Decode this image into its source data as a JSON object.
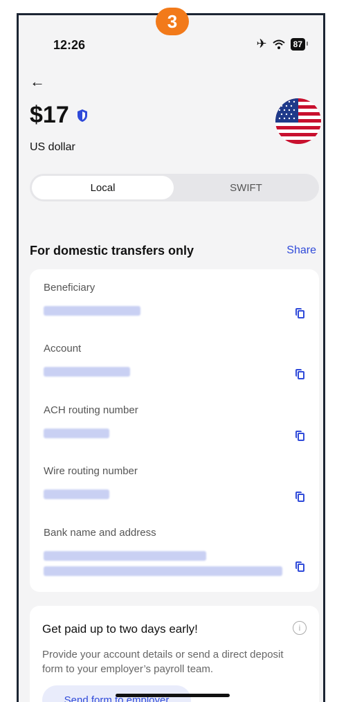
{
  "annotation": {
    "step": "3"
  },
  "status_bar": {
    "time": "12:26",
    "battery": "87"
  },
  "header": {
    "back_icon": "←",
    "amount": "$17",
    "currency_name": "US dollar"
  },
  "tabs": [
    {
      "label": "Local",
      "selected": true
    },
    {
      "label": "SWIFT",
      "selected": false
    }
  ],
  "section": {
    "title": "For domestic transfers only",
    "share_label": "Share"
  },
  "fields": [
    {
      "label": "Beneficiary"
    },
    {
      "label": "Account"
    },
    {
      "label": "ACH routing number"
    },
    {
      "label": "Wire routing number"
    },
    {
      "label": "Bank name and address"
    }
  ],
  "promo": {
    "title": "Get paid up to two days early!",
    "info_icon": "i",
    "text": "Provide your account details or send a direct deposit form to your employer’s payroll team.",
    "button_label": "Send form to employer"
  },
  "colors": {
    "accent": "#2f4ad9",
    "badge": "#f27a1a",
    "background": "#f4f4f5"
  }
}
